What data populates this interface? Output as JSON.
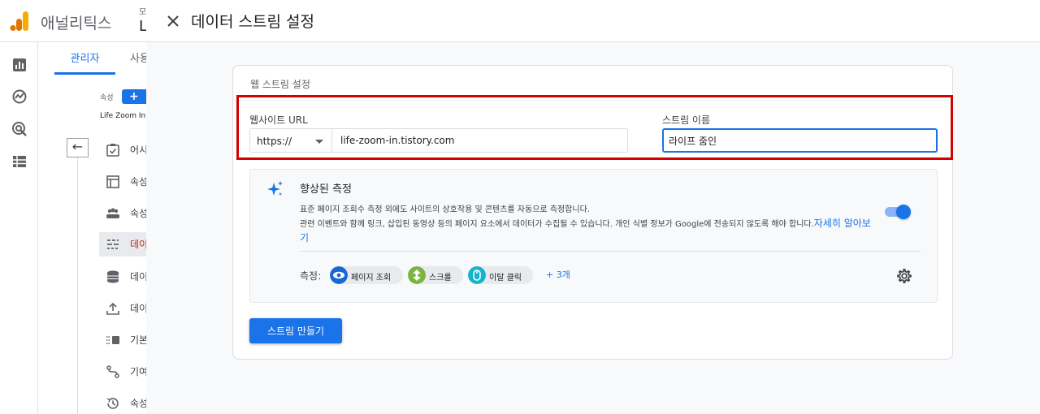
{
  "app": {
    "name": "애널리틱스",
    "account_small": "모",
    "account_big": "L"
  },
  "admin_panel": {
    "tab_admin": "관리자",
    "tab_user": "사용",
    "property_label": "속성",
    "add_label": "+",
    "property_name": "Life Zoom In (",
    "back_arrow": "←",
    "menu": [
      {
        "label": "어시",
        "icon": "checklist-icon",
        "active": false
      },
      {
        "label": "속성",
        "icon": "property-settings-icon",
        "active": false
      },
      {
        "label": "속성",
        "icon": "people-icon",
        "active": false
      },
      {
        "label": "데이",
        "icon": "data-streams-icon",
        "active": true
      },
      {
        "label": "데이",
        "icon": "database-icon",
        "active": false
      },
      {
        "label": "데이",
        "icon": "upload-icon",
        "active": false
      },
      {
        "label": "기본",
        "icon": "report-identity-icon",
        "active": false
      },
      {
        "label": "기여",
        "icon": "attribution-icon",
        "active": false
      },
      {
        "label": "속성",
        "icon": "history-icon",
        "active": false
      }
    ]
  },
  "dialog": {
    "title": "데이터 스트림 설정",
    "card_title": "웹 스트림 설정",
    "website_url": {
      "label": "웹사이트 URL",
      "protocol": "https://",
      "value": "life-zoom-in.tistory.com"
    },
    "stream_name": {
      "label": "스트림 이름",
      "value": "라이프 줌인"
    },
    "enhanced": {
      "title": "향상된 측정",
      "desc_line1": "표준 페이지 조회수 측정 외에도 사이트의 상호작용 및 콘텐츠를 자동으로 측정합니다.",
      "desc_line2": "관련 이벤트와 함께 링크, 삽입된 동영상 등의 페이지 요소에서 데이터가 수집될 수 있습니다. 개인 식별 정보가 Google에 전송되지 않도록 해야 합니다.",
      "learn_more": "자세히 알아보기",
      "toggle_on": true,
      "measure_label": "측정:",
      "chips": [
        {
          "label": "페이지 조회",
          "icon": "eye-icon",
          "color": "#1967d2"
        },
        {
          "label": "스크롤",
          "icon": "scroll-icon",
          "color": "#7cb342"
        },
        {
          "label": "이탈 클릭",
          "icon": "mouse-icon",
          "color": "#12b5cb"
        }
      ],
      "more": "+ 3개"
    },
    "create_button": "스트림 만들기"
  },
  "colors": {
    "accent": "#1a73e8",
    "highlight_border": "#d50000"
  }
}
